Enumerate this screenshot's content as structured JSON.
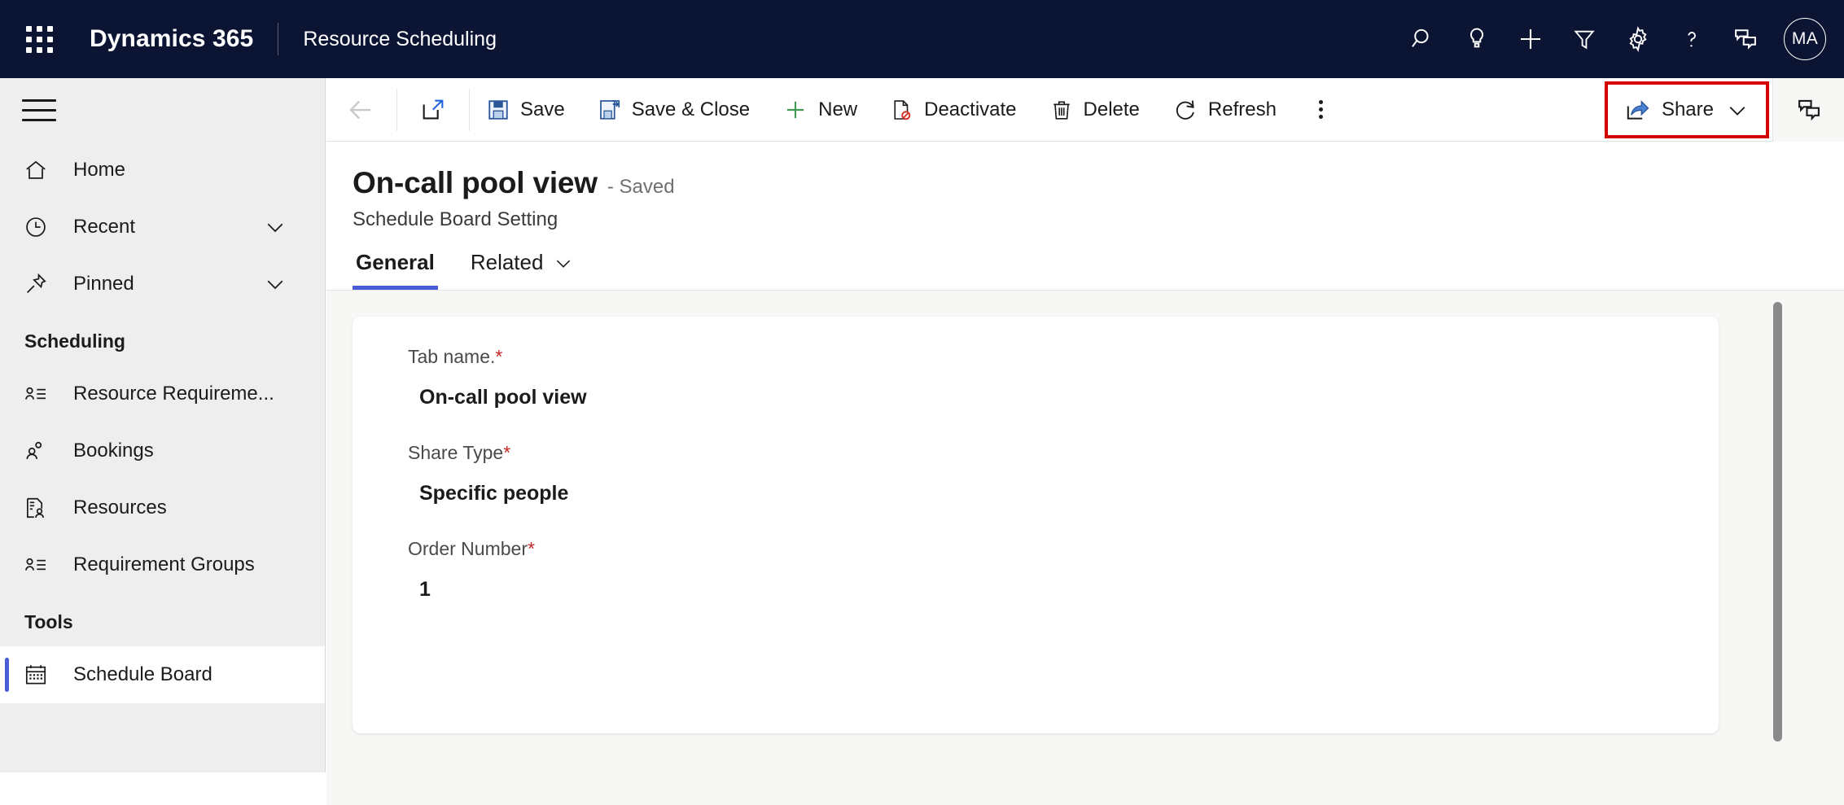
{
  "header": {
    "waffle_icon": "app-launcher-icon",
    "brand": "Dynamics 365",
    "app_name": "Resource Scheduling",
    "icons": [
      {
        "name": "search-icon"
      },
      {
        "name": "lightbulb-icon"
      },
      {
        "name": "plus-icon"
      },
      {
        "name": "filter-icon"
      },
      {
        "name": "gear-icon"
      },
      {
        "name": "help-icon"
      },
      {
        "name": "feedback-icon"
      }
    ],
    "avatar_initials": "MA"
  },
  "sidebar": {
    "hamburger_icon": "hamburger-icon",
    "items": [
      {
        "label": "Home",
        "icon": "home-icon",
        "chevron": false,
        "selected": false
      },
      {
        "label": "Recent",
        "icon": "clock-icon",
        "chevron": true,
        "selected": false
      },
      {
        "label": "Pinned",
        "icon": "pin-icon",
        "chevron": true,
        "selected": false
      }
    ],
    "groups": [
      {
        "title": "Scheduling",
        "items": [
          {
            "label": "Resource Requireme...",
            "icon": "contact-list-icon",
            "selected": false
          },
          {
            "label": "Bookings",
            "icon": "people-icon",
            "selected": false
          },
          {
            "label": "Resources",
            "icon": "resource-icon",
            "selected": false
          },
          {
            "label": "Requirement Groups",
            "icon": "contact-list-icon",
            "selected": false
          }
        ]
      },
      {
        "title": "Tools",
        "items": [
          {
            "label": "Schedule Board",
            "icon": "calendar-icon",
            "selected": true
          }
        ]
      }
    ]
  },
  "commandbar": {
    "back_label": "Back",
    "back_icon": "arrow-left-icon",
    "popout_icon": "popout-icon",
    "buttons": [
      {
        "label": "Save",
        "icon": "save-icon"
      },
      {
        "label": "Save & Close",
        "icon": "save-close-icon"
      },
      {
        "label": "New",
        "icon": "plus-icon"
      },
      {
        "label": "Deactivate",
        "icon": "deactivate-icon"
      },
      {
        "label": "Delete",
        "icon": "trash-icon"
      },
      {
        "label": "Refresh",
        "icon": "refresh-icon"
      }
    ],
    "overflow_icon": "more-options-icon",
    "share": {
      "label": "Share",
      "icon": "share-icon",
      "chevron_icon": "chevron-down-icon",
      "highlight_color": "#d40000"
    },
    "chat_icon": "feedback-icon"
  },
  "record": {
    "title": "On-call pool view",
    "status": "- Saved",
    "entity": "Schedule Board Setting"
  },
  "tabs": [
    {
      "label": "General",
      "active": true,
      "chevron": false
    },
    {
      "label": "Related",
      "active": false,
      "chevron": true
    }
  ],
  "form": {
    "fields": [
      {
        "label": "Tab name.",
        "required": true,
        "value": "On-call pool view"
      },
      {
        "label": "Share Type",
        "required": true,
        "value": "Specific people"
      },
      {
        "label": "Order Number",
        "required": true,
        "value": "1"
      }
    ]
  },
  "colors": {
    "header_bg": "#0b1533",
    "accent": "#4a5bd6",
    "sidebar_bg": "#eeeeee",
    "canvas_bg": "#f7f7f5",
    "required_asterisk": "#c62828",
    "highlight": "#d40000"
  }
}
